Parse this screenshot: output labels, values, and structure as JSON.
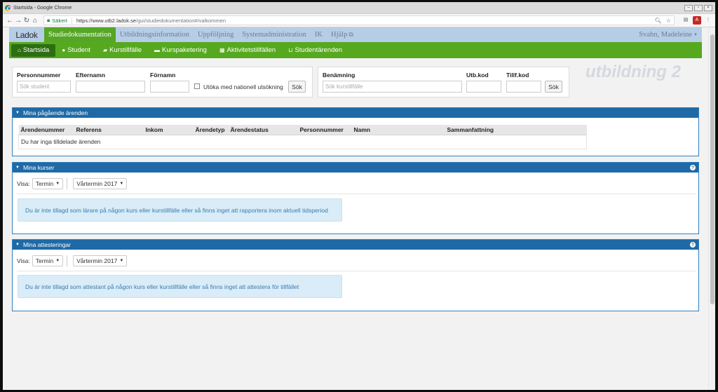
{
  "browser": {
    "window_title": "Startsida - Google Chrome",
    "secure_label": "Säkert",
    "url_host": "https://www.utb2.ladok.se",
    "url_path": "/gui/studiedokumentation#/valkommen"
  },
  "topnav": {
    "logo": "Ladok",
    "tabs": [
      "Studiedokumentation",
      "Utbildningsinformation",
      "Uppföljning",
      "Systemadministration",
      "IK",
      "Hjälp"
    ],
    "user": "Svahn, Madeleine"
  },
  "subnav": {
    "items": [
      "Startsida",
      "Student",
      "Kurstillfälle",
      "Kurspaketering",
      "Aktivitetstillfällen",
      "Studentärenden"
    ]
  },
  "student_search": {
    "personnummer_label": "Personnummer",
    "personnummer_placeholder": "Sök student",
    "efternamn_label": "Efternamn",
    "fornamn_label": "Förnamn",
    "national_label": "Utöka med nationell utsökning",
    "search_button": "Sök"
  },
  "course_search": {
    "benamning_label": "Benämning",
    "benamning_placeholder": "Sök kurstillfälle",
    "utbkod_label": "Utb.kod",
    "tillfkod_label": "Tillf.kod",
    "search_button": "Sök"
  },
  "watermark": "utbildning 2",
  "cases_panel": {
    "title": "Mina pågående ärenden",
    "columns": [
      "Ärendenummer",
      "Referens",
      "Inkom",
      "Ärendetyp",
      "Ärendestatus",
      "Personnummer",
      "Namn",
      "Sammanfattning"
    ],
    "empty_message": "Du har inga tilldelade ärenden"
  },
  "courses_panel": {
    "title": "Mina kurser",
    "visa_label": "Visa:",
    "filter_type": "Termin",
    "term": "Vårtermin 2017",
    "message": "Du är inte tillagd som lärare på någon kurs eller kurstillfälle eller så finns inget att rapportera inom aktuell tidsperiod"
  },
  "attest_panel": {
    "title": "Mina attesteringar",
    "visa_label": "Visa:",
    "filter_type": "Termin",
    "term": "Vårtermin 2017",
    "message": "Du är inte tillagd som attestant på någon kurs eller kurstillfälle eller så finns inget att attestera för tillfället"
  },
  "colors": {
    "nav_green": "#56a91f",
    "top_nav_blue": "#b6cde6",
    "panel_header": "#1f6aa6"
  }
}
